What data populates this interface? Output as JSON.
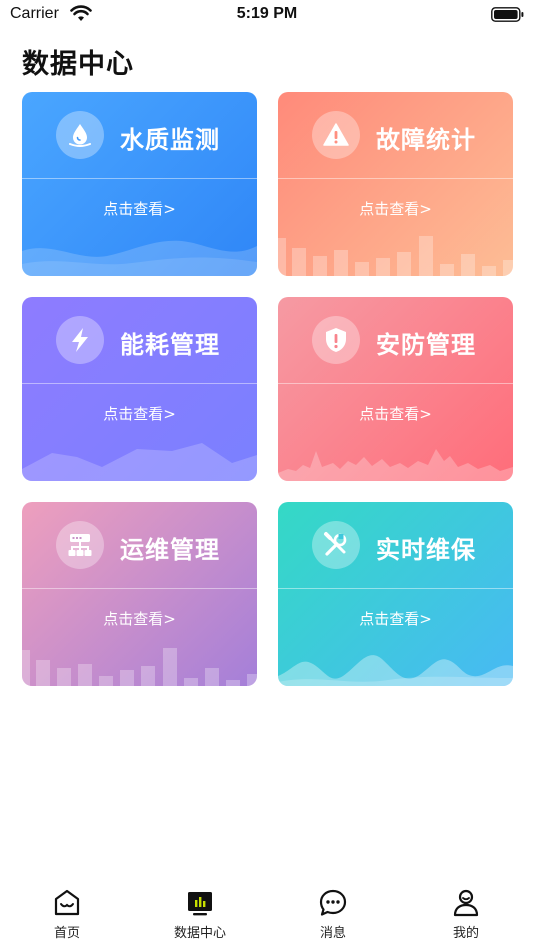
{
  "status_bar": {
    "carrier": "Carrier",
    "time": "5:19 PM"
  },
  "page": {
    "title": "数据中心"
  },
  "cards": [
    {
      "title": "水质监测",
      "link": "点击查看>",
      "icon": "water-drop-icon"
    },
    {
      "title": "故障统计",
      "link": "点击查看>",
      "icon": "warning-icon"
    },
    {
      "title": "能耗管理",
      "link": "点击查看>",
      "icon": "lightning-icon"
    },
    {
      "title": "安防管理",
      "link": "点击查看>",
      "icon": "shield-icon"
    },
    {
      "title": "运维管理",
      "link": "点击查看>",
      "icon": "network-icon"
    },
    {
      "title": "实时维保",
      "link": "点击查看>",
      "icon": "tools-icon"
    }
  ],
  "tabs": [
    {
      "label": "首页",
      "icon": "home-icon",
      "active": false
    },
    {
      "label": "数据中心",
      "icon": "data-center-icon",
      "active": true
    },
    {
      "label": "消息",
      "icon": "message-icon",
      "active": false
    },
    {
      "label": "我的",
      "icon": "user-icon",
      "active": false
    }
  ],
  "colors": {
    "accent_active": "#c8e000",
    "text_dark": "#222222"
  }
}
